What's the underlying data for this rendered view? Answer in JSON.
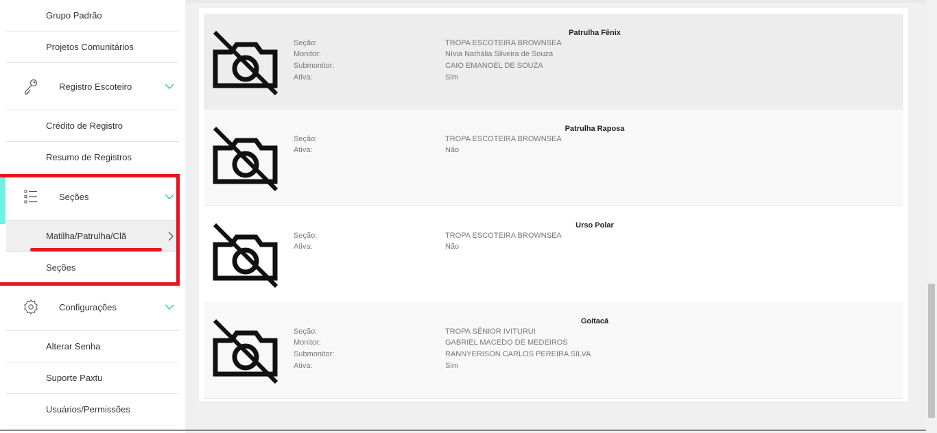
{
  "sidebar": {
    "items": [
      {
        "type": "sub",
        "label": "Grupo Padrão"
      },
      {
        "type": "sub",
        "label": "Projetos Comunitários"
      },
      {
        "type": "group",
        "label": "Registro Escoteiro",
        "icon": "key-icon"
      },
      {
        "type": "sub",
        "label": "Crédito de Registro"
      },
      {
        "type": "sub",
        "label": "Resumo de Registros"
      },
      {
        "type": "group",
        "label": "Seções",
        "icon": "list-icon"
      },
      {
        "type": "sub",
        "label": "Matilha/Patrulha/Clã",
        "active": true
      },
      {
        "type": "sub",
        "label": "Seções"
      },
      {
        "type": "group",
        "label": "Configurações",
        "icon": "gear-icon"
      },
      {
        "type": "sub",
        "label": "Alterar Senha"
      },
      {
        "type": "sub",
        "label": "Suporte Paxtu"
      },
      {
        "type": "sub",
        "label": "Usuários/Permissões"
      }
    ]
  },
  "cards": [
    {
      "title": "Patrulha Fênix",
      "fields": [
        {
          "k": "Seção:",
          "v": "TROPA ESCOTEIRA BROWNSEA"
        },
        {
          "k": "Monitor:",
          "v": "Nívia Nathália Silveira de Souza"
        },
        {
          "k": "Submonitor:",
          "v": "CAIO EMANOEL DE SOUZA"
        },
        {
          "k": "Ativa:",
          "v": "Sim"
        }
      ]
    },
    {
      "title": "Patrulha Raposa",
      "fields": [
        {
          "k": "Seção:",
          "v": "TROPA ESCOTEIRA BROWNSEA"
        },
        {
          "k": "Ativa:",
          "v": "Não"
        }
      ]
    },
    {
      "title": "Urso Polar",
      "fields": [
        {
          "k": "Seção:",
          "v": "TROPA ESCOTEIRA BROWNSEA"
        },
        {
          "k": "Ativa:",
          "v": "Não"
        }
      ]
    },
    {
      "title": "Goitacá",
      "fields": [
        {
          "k": "Seção:",
          "v": "TROPA SÊNIOR IVITURUI"
        },
        {
          "k": "Monitor:",
          "v": "GABRIEL MACEDO DE MEDEIROS"
        },
        {
          "k": "Submonitor:",
          "v": "RANNYERISON CARLOS PEREIRA SILVA"
        },
        {
          "k": "Ativa:",
          "v": "Sim"
        }
      ]
    }
  ],
  "colors": {
    "accent": "#6ff0e0",
    "highlight": "#e8141c",
    "chevron": "#3bbfb0"
  }
}
